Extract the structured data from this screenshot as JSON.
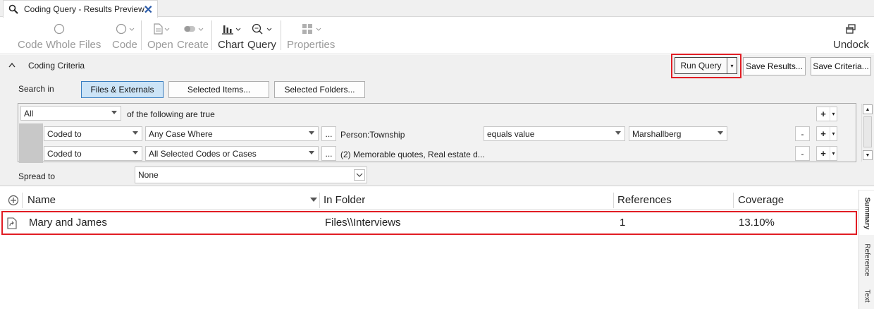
{
  "tab": {
    "title": "Coding Query - Results Preview",
    "close": "✕"
  },
  "ribbon": {
    "code_whole_files": "Code Whole Files",
    "code": "Code",
    "open": "Open",
    "create": "Create",
    "chart": "Chart",
    "query": "Query",
    "properties": "Properties",
    "undock": "Undock"
  },
  "criteria": {
    "section_title": "Coding Criteria",
    "run_query": "Run Query",
    "save_results": "Save Results...",
    "save_criteria": "Save Criteria...",
    "search_in_label": "Search in",
    "search_in_options": [
      "Files & Externals",
      "Selected Items...",
      "Selected Folders..."
    ],
    "selected_search_in": "Files & Externals",
    "match_mode": "All",
    "match_text": "of the following are true",
    "rows": [
      {
        "type": "Coded to",
        "scope": "Any Case Where",
        "detail": "Person:Township",
        "operator": "equals value",
        "value": "Marshallberg"
      },
      {
        "type": "Coded to",
        "scope": "All Selected Codes or Cases",
        "detail": "(2) Memorable quotes, Real estate d..."
      }
    ],
    "spread_label": "Spread to",
    "spread_value": "None",
    "ellipsis": "...",
    "plus": "+",
    "minus": "-"
  },
  "results": {
    "columns": [
      "Name",
      "In Folder",
      "References",
      "Coverage"
    ],
    "rows": [
      {
        "name": "Mary and James",
        "folder": "Files\\\\Interviews",
        "references": "1",
        "coverage": "13.10%"
      }
    ],
    "side_tabs": [
      "Summary",
      "Reference",
      "Text"
    ]
  },
  "colors": {
    "highlight": "#e11d24",
    "selected_button": "#cce4f7",
    "panel_bg": "#f0f0f0"
  }
}
